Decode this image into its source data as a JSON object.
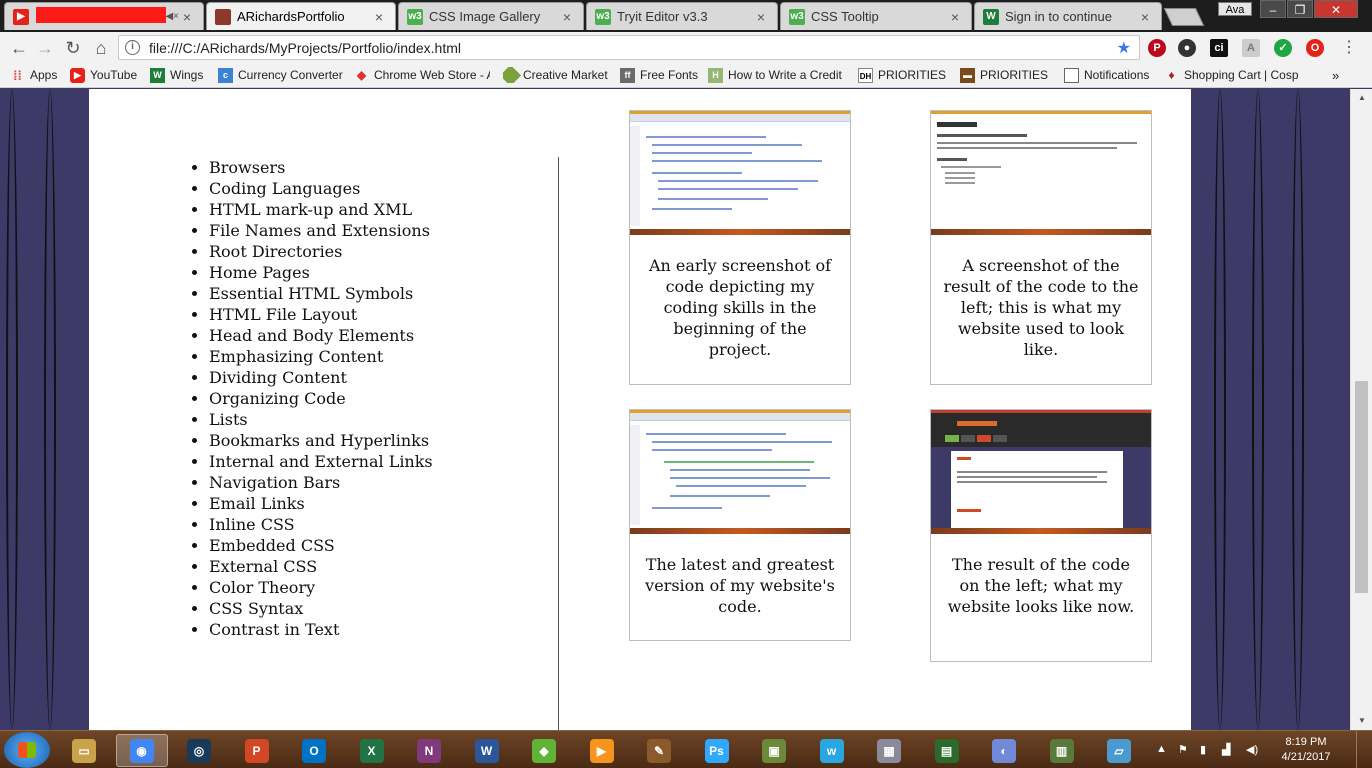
{
  "browser": {
    "tabs": [
      {
        "title": "",
        "icon": "youtube-icon",
        "muted": true
      },
      {
        "title": "ARichardsPortfolio",
        "icon": "portfolio-icon",
        "active": true
      },
      {
        "title": "CSS Image Gallery",
        "icon": "w3schools-icon"
      },
      {
        "title": "Tryit Editor v3.3",
        "icon": "w3schools-icon"
      },
      {
        "title": "CSS Tooltip",
        "icon": "w3schools-icon"
      },
      {
        "title": "Sign in to continue",
        "icon": "wikispaces-icon"
      }
    ],
    "user": "Ava",
    "address": "file:///C:/ARichards/MyProjects/Portfolio/index.html"
  },
  "bookmarks": [
    {
      "label": "Apps",
      "icon": "apps-grid-icon"
    },
    {
      "label": "YouTube",
      "icon": "youtube-icon"
    },
    {
      "label": "Wings",
      "icon": "wikispaces-icon"
    },
    {
      "label": "Currency Converter",
      "icon": "currency-icon"
    },
    {
      "label": "Chrome Web Store - A",
      "icon": "webstore-icon"
    },
    {
      "label": "Creative Market",
      "icon": "creative-market-icon"
    },
    {
      "label": "Free Fonts",
      "icon": "fonts-icon"
    },
    {
      "label": "How to Write a Credit",
      "icon": "wikihow-icon"
    },
    {
      "label": "PRIORITIES 1",
      "icon": "dh-icon"
    },
    {
      "label": "PRIORITIES 2",
      "icon": "briefcase-icon"
    },
    {
      "label": "Notifications",
      "icon": "page-icon"
    },
    {
      "label": "Shopping Cart | Cospla",
      "icon": "cart-icon"
    }
  ],
  "topics": [
    "Browsers",
    "Coding Languages",
    "HTML mark-up and XML",
    "File Names and Extensions",
    "Root Directories",
    "Home Pages",
    "Essential HTML Symbols",
    "HTML File Layout",
    "Head and Body Elements",
    "Emphasizing Content",
    "Dividing Content",
    "Organizing Code",
    "Lists",
    "Bookmarks and Hyperlinks",
    "Internal and External Links",
    "Navigation Bars",
    "Email Links",
    "Inline CSS",
    "Embedded CSS",
    "External CSS",
    "Color Theory",
    "CSS Syntax",
    "Contrast in Text"
  ],
  "gallery": [
    {
      "caption": "An early screenshot of code depicting my coding skills in the beginning of the project."
    },
    {
      "caption": "A screenshot of the result of the code to the left; this is what my website used to look like."
    },
    {
      "caption": "The latest and greatest version of my website's code."
    },
    {
      "caption": "The result of the code on the left; what my website looks like now."
    }
  ],
  "taskbar": {
    "time": "8:19 PM",
    "date": "4/21/2017",
    "apps": [
      "file-explorer-icon",
      "chrome-icon",
      "steam-icon",
      "powerpoint-icon",
      "outlook-icon",
      "excel-icon",
      "onenote-icon",
      "word-icon",
      "sims-icon",
      "media-player-icon",
      "paint-pencil-icon",
      "photoshop-icon",
      "game-icon",
      "wattpad-icon",
      "calculator-icon",
      "terminal-icon",
      "discord-icon",
      "notepad-icon",
      "snipping-icon"
    ]
  },
  "colors": {
    "page_background": "#3d3a68",
    "content_background": "#ffffff",
    "accent_blue": "#3b78e7",
    "taskbar": "#5a3519"
  }
}
